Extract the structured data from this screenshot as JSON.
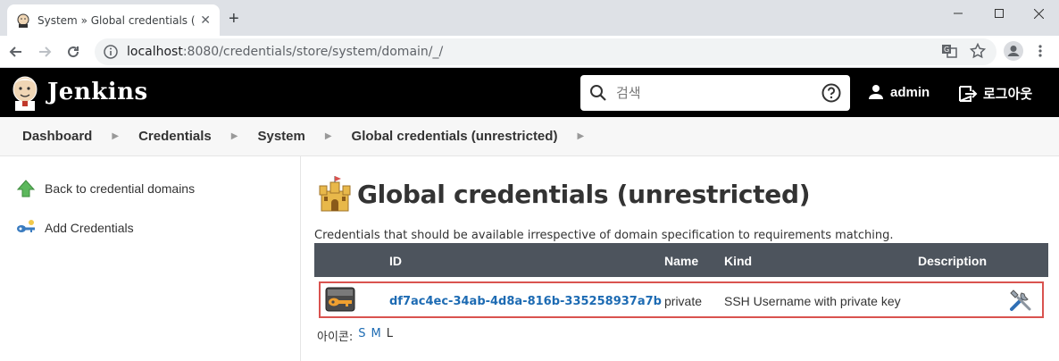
{
  "browser": {
    "tab_title": "System » Global credentials (un",
    "url_host": "localhost",
    "url_path": ":8080/credentials/store/system/domain/_/"
  },
  "header": {
    "title": "Jenkins",
    "search_placeholder": "검색",
    "user": "admin",
    "logout": "로그아웃"
  },
  "breadcrumb": [
    "Dashboard",
    "Credentials",
    "System",
    "Global credentials (unrestricted)"
  ],
  "sidebar": {
    "items": [
      {
        "label": "Back to credential domains",
        "icon": "up-arrow-icon"
      },
      {
        "label": "Add Credentials",
        "icon": "key-icon"
      }
    ]
  },
  "main": {
    "title": "Global credentials (unrestricted)",
    "description": "Credentials that should be available irrespective of domain specification to requirements matching.",
    "table": {
      "headers": {
        "id": "ID",
        "name": "Name",
        "kind": "Kind",
        "description": "Description"
      },
      "rows": [
        {
          "id": "df7ac4ec-34ab-4d8a-816b-335258937a7b",
          "name": "private",
          "kind": "SSH Username with private key",
          "description": ""
        }
      ]
    },
    "icon_size": {
      "label": "아이콘:",
      "s": "S",
      "m": "M",
      "l": "L"
    }
  },
  "colors": {
    "header_bg": "#000000",
    "table_header_bg": "#4d545d",
    "link": "#1d6bb3",
    "highlight_border": "#d9534f"
  }
}
